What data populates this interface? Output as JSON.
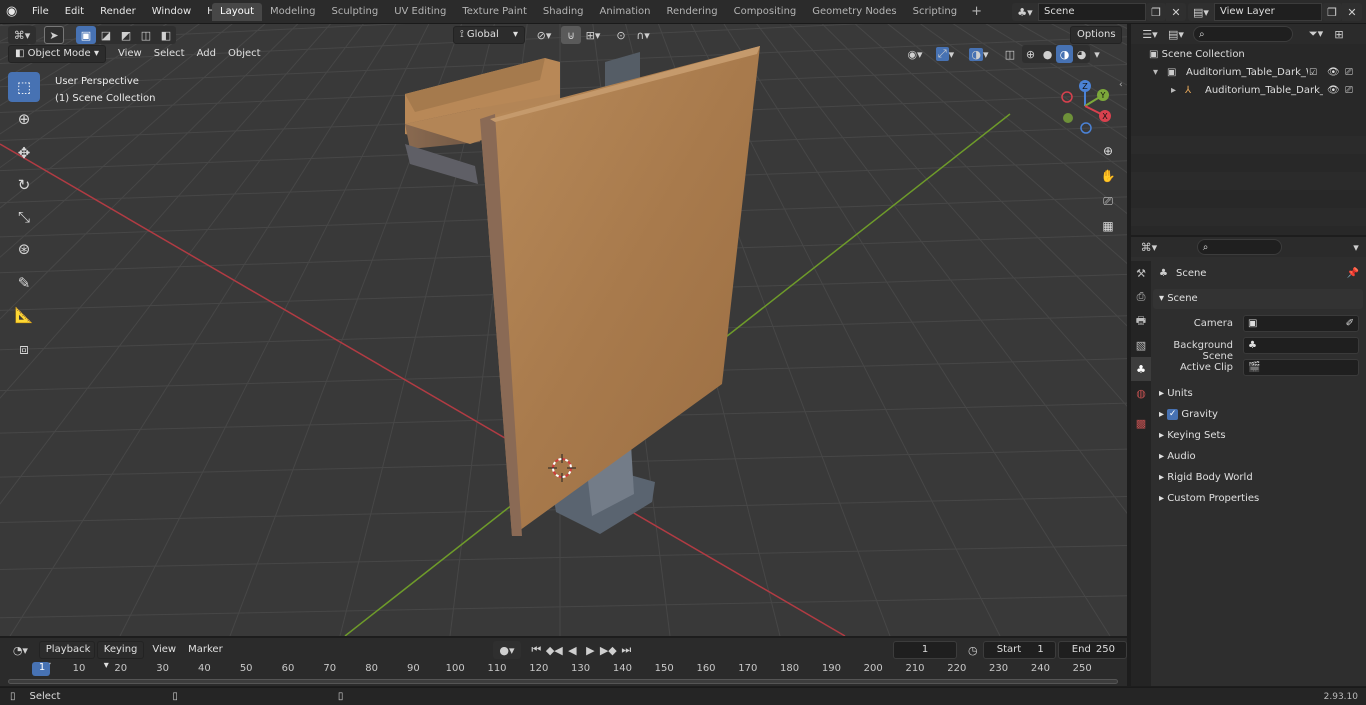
{
  "topbar": {
    "menus": [
      "File",
      "Edit",
      "Render",
      "Window",
      "Help"
    ],
    "workspace_tabs": [
      "Layout",
      "Modeling",
      "Sculpting",
      "UV Editing",
      "Texture Paint",
      "Shading",
      "Animation",
      "Rendering",
      "Compositing",
      "Geometry Nodes",
      "Scripting"
    ],
    "active_tab": "Layout",
    "add_tab": "+",
    "scene_name": "Scene",
    "view_layer_name": "View Layer"
  },
  "viewport": {
    "mode": "Object Mode",
    "menus": [
      "View",
      "Select",
      "Add",
      "Object"
    ],
    "orientation": "Global",
    "options_label": "Options",
    "overlay_line1": "User Perspective",
    "overlay_line2": "(1) Scene Collection",
    "gizmo_axes": {
      "x": "X",
      "y": "Y",
      "z": "Z"
    },
    "colors": {
      "background": "#393939",
      "grid": "#4a4a4a",
      "x_axis": "#b13b43",
      "y_axis": "#6e9b2a",
      "wood": "#b07d4f"
    }
  },
  "outliner": {
    "search_placeholder": "",
    "root": "Scene Collection",
    "collection": "Auditorium_Table_Dark_Wood",
    "object": "Auditorium_Table_Dark_Wood"
  },
  "properties": {
    "header_title": "Scene",
    "section": "Scene",
    "fields": [
      {
        "label": "Camera",
        "value": ""
      },
      {
        "label": "Background Scene",
        "value": ""
      },
      {
        "label": "Active Clip",
        "value": ""
      }
    ],
    "panels": [
      "Units",
      "Gravity",
      "Keying Sets",
      "Audio",
      "Rigid Body World",
      "Custom Properties"
    ],
    "gravity_checked": true
  },
  "timeline": {
    "menus": [
      "Playback",
      "Keying",
      "View",
      "Marker"
    ],
    "current_frame": "1",
    "start_label": "Start",
    "start_value": "1",
    "end_label": "End",
    "end_value": "250",
    "ruler": [
      "1",
      "10",
      "20",
      "30",
      "40",
      "50",
      "60",
      "70",
      "80",
      "90",
      "100",
      "110",
      "120",
      "130",
      "140",
      "150",
      "160",
      "170",
      "180",
      "190",
      "200",
      "210",
      "220",
      "230",
      "240",
      "250"
    ]
  },
  "statusbar": {
    "left": "Select",
    "version": "2.93.10"
  }
}
